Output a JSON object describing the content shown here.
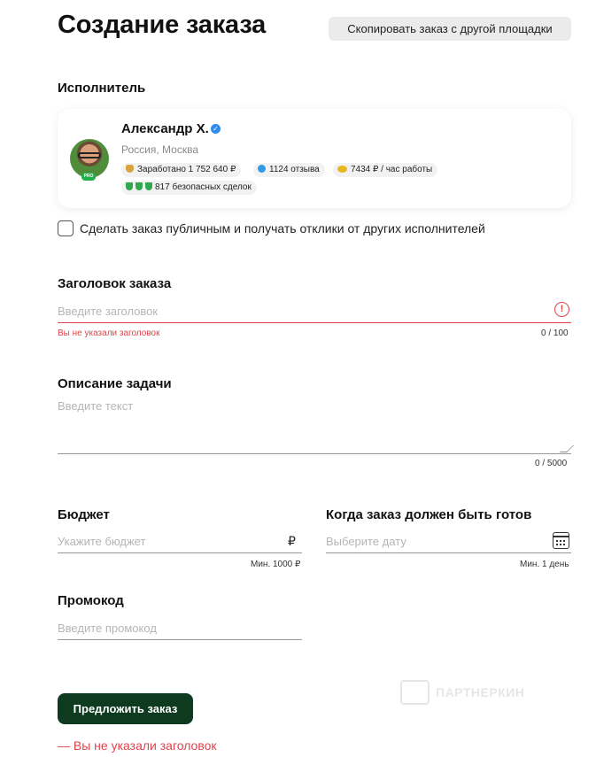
{
  "header": {
    "title": "Создание заказа",
    "copy_button": "Скопировать заказ с другой площадки"
  },
  "executor": {
    "section_label": "Исполнитель",
    "name": "Александр Х.",
    "location": "Россия, Москва",
    "badge": "PRO",
    "stats": {
      "earned": "Заработано 1 752 640 ₽",
      "reviews": "1124 отзыва",
      "rate": "7434 ₽ / час работы",
      "deals": "817 безопасных сделок"
    }
  },
  "public_option": {
    "label": "Сделать заказ публичным и получать отклики от других исполнителей",
    "checked": false
  },
  "title_field": {
    "label": "Заголовок заказа",
    "placeholder": "Введите заголовок",
    "error": "Вы не указали заголовок",
    "counter": "0 / 100"
  },
  "description_field": {
    "label": "Описание задачи",
    "placeholder": "Введите текст",
    "counter": "0 / 5000"
  },
  "budget_field": {
    "label": "Бюджет",
    "placeholder": "Укажите бюджет",
    "currency": "₽",
    "hint": "Мин. 1000 ₽"
  },
  "deadline_field": {
    "label": "Когда заказ должен быть готов",
    "placeholder": "Выберите дату",
    "hint": "Мин. 1 день"
  },
  "promo_field": {
    "label": "Промокод",
    "placeholder": "Введите промокод"
  },
  "submit": {
    "label": "Предложить заказ",
    "error": "— Вы не указали заголовок"
  },
  "watermark": "ПАРТНЕРКИН",
  "colors": {
    "accent": "#0e3b1f",
    "error": "#e0434b",
    "verified": "#2d8cf0",
    "pro": "#22b04a"
  },
  "icons": [
    "verified-icon",
    "coin-bag-icon",
    "chat-bubble-icon",
    "coins-icon",
    "shield-icon",
    "error-icon",
    "calendar-icon",
    "resize-handle-icon"
  ]
}
